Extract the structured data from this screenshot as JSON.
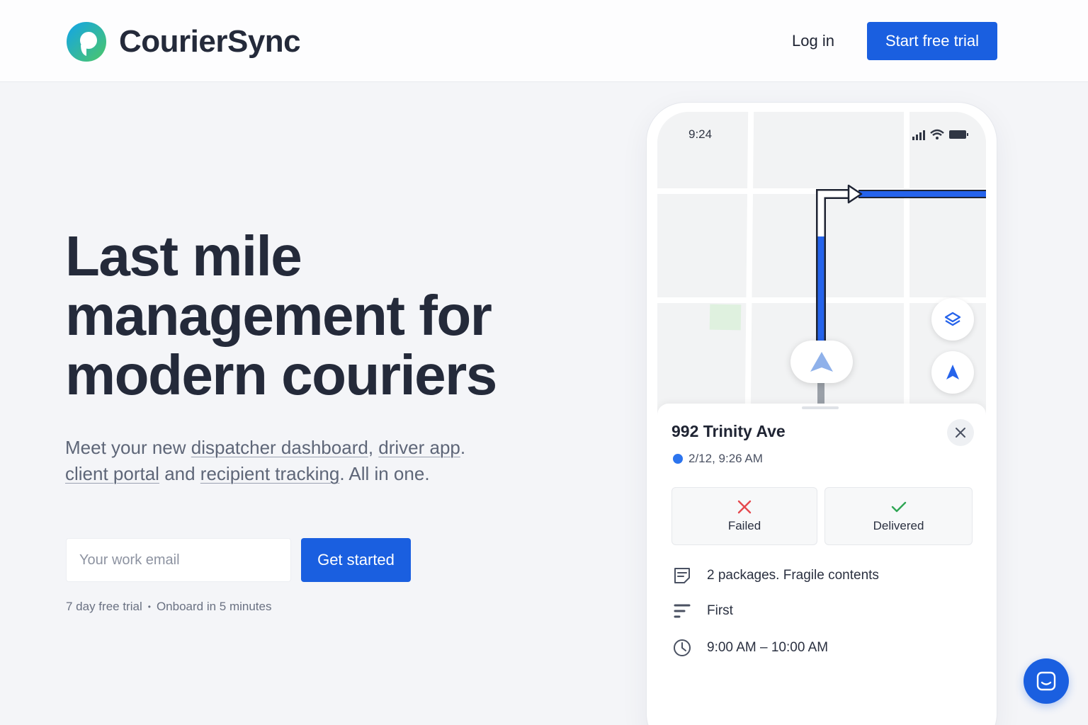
{
  "brand": {
    "name": "CourierSync",
    "logo_colors": [
      "#1aa6e8",
      "#45c06a"
    ]
  },
  "header": {
    "login_label": "Log in",
    "trial_label": "Start free trial"
  },
  "hero": {
    "headline": [
      "Last mile",
      "management for",
      "modern couriers"
    ],
    "sub": {
      "p1": "Meet your new ",
      "link1": "dispatcher dashboard",
      "p2": ", ",
      "link2": "driver app",
      "p3": ".",
      "link3": "client portal",
      "p4": " and ",
      "link4": "recipient tracking",
      "p5": ". All in one."
    },
    "email_placeholder": "Your work email",
    "cta_label": "Get started",
    "fine_1": "7 day free trial",
    "fine_sep": "•",
    "fine_2": "Onboard in 5 minutes"
  },
  "phone": {
    "status_time": "9:24",
    "stop": {
      "address": "992 Trinity Ave",
      "datetime": "2/12, 9:26 AM",
      "failed_label": "Failed",
      "delivered_label": "Delivered",
      "notes": "2 packages. Fragile contents",
      "priority": "First",
      "window": "9:00 AM – 10:00 AM"
    }
  },
  "colors": {
    "accent": "#1a5fe0",
    "route": "#2563eb",
    "failed": "#e5484d",
    "delivered": "#2fa654"
  }
}
